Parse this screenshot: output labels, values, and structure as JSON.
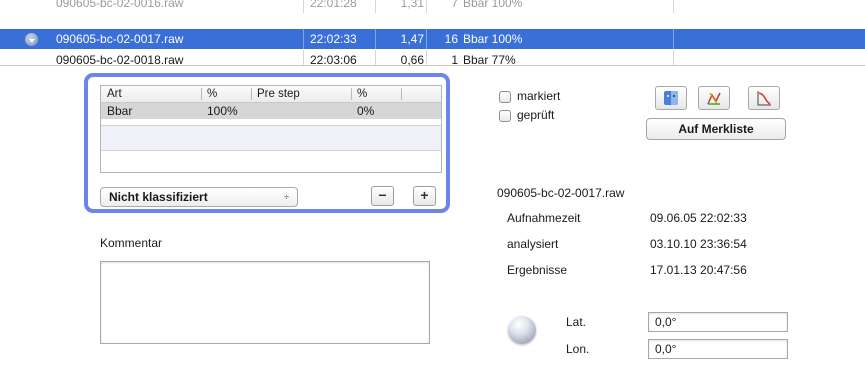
{
  "file_list": {
    "rows": [
      {
        "name": "090605-bc-02-0016.raw",
        "time": "22:01:28",
        "value": "1,31",
        "count": "7",
        "result": "Bbar 100%"
      },
      {
        "name": "090605-bc-02-0017.raw",
        "time": "22:02:33",
        "value": "1,47",
        "count": "16",
        "result": "Bbar 100%"
      },
      {
        "name": "090605-bc-02-0018.raw",
        "time": "22:03:06",
        "value": "0,66",
        "count": "1",
        "result": "Bbar 77%"
      }
    ]
  },
  "classification": {
    "headers": [
      "Art",
      "%",
      "Pre step",
      "%"
    ],
    "rows": [
      {
        "art": "Bbar",
        "pct": "100%",
        "pre_step": "",
        "pct2": "0%"
      }
    ],
    "popup_value": "Nicht klassifiziert",
    "popup_arrow": "÷",
    "minus": "−",
    "plus": "+"
  },
  "comment": {
    "label": "Kommentar",
    "value": ""
  },
  "flags": {
    "markiert": "markiert",
    "geprueft": "geprüft"
  },
  "toolbar": {
    "icons": [
      "finder-icon",
      "chart-icon",
      "curve-icon"
    ],
    "merkliste": "Auf Merkliste"
  },
  "info": {
    "filename": "090605-bc-02-0017.raw",
    "rows": [
      {
        "label": "Aufnahmezeit",
        "value": "09.06.05 22:02:33"
      },
      {
        "label": "analysiert",
        "value": "03.10.10 23:36:54"
      },
      {
        "label": "Ergebnisse",
        "value": "17.01.13 20:47:56"
      }
    ]
  },
  "location": {
    "lat_label": "Lat.",
    "lat_value": "0,0°",
    "lon_label": "Lon.",
    "lon_value": "0,0°"
  },
  "colors": {
    "selection": "#3a6fd8",
    "focus_ring": "#6b86e8"
  }
}
